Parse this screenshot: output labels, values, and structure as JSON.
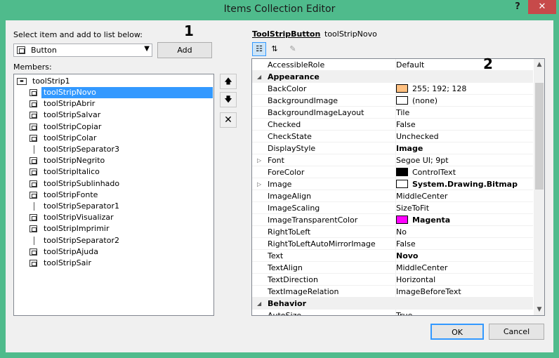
{
  "window": {
    "title": "Items Collection Editor",
    "help": "?",
    "close": "✕"
  },
  "left": {
    "select_label": "Select item and add to list below:",
    "combo_value": "Button",
    "add_label": "Add",
    "members_label": "Members:",
    "root": "toolStrip1",
    "items": [
      {
        "name": "toolStripNovo",
        "kind": "button"
      },
      {
        "name": "toolStripAbrir",
        "kind": "button"
      },
      {
        "name": "toolStripSalvar",
        "kind": "button"
      },
      {
        "name": "toolStripCopiar",
        "kind": "button"
      },
      {
        "name": "toolStripColar",
        "kind": "button"
      },
      {
        "name": "toolStripSeparator3",
        "kind": "separator"
      },
      {
        "name": "toolStripNegrito",
        "kind": "button"
      },
      {
        "name": "toolStripItalico",
        "kind": "button"
      },
      {
        "name": "toolStripSublinhado",
        "kind": "button"
      },
      {
        "name": "toolStripFonte",
        "kind": "button"
      },
      {
        "name": "toolStripSeparator1",
        "kind": "separator"
      },
      {
        "name": "toolStripVisualizar",
        "kind": "button"
      },
      {
        "name": "toolStripImprimir",
        "kind": "button"
      },
      {
        "name": "toolStripSeparator2",
        "kind": "separator"
      },
      {
        "name": "toolStripAjuda",
        "kind": "button"
      },
      {
        "name": "toolStripSair",
        "kind": "button"
      }
    ],
    "selected_index": 0,
    "move_up": "🡅",
    "move_down": "🡇",
    "remove": "✕"
  },
  "right": {
    "object_type": "ToolStripButton",
    "object_name": "toolStripNovo",
    "rows": [
      {
        "type": "prop",
        "name": "AccessibleRole",
        "value": "Default"
      },
      {
        "type": "cat",
        "name": "Appearance"
      },
      {
        "type": "prop",
        "name": "BackColor",
        "value": "255; 192; 128",
        "swatch": "#ffc080"
      },
      {
        "type": "prop",
        "name": "BackgroundImage",
        "value": "(none)",
        "swatch": "#ffffff"
      },
      {
        "type": "prop",
        "name": "BackgroundImageLayout",
        "value": "Tile"
      },
      {
        "type": "prop",
        "name": "Checked",
        "value": "False"
      },
      {
        "type": "prop",
        "name": "CheckState",
        "value": "Unchecked"
      },
      {
        "type": "prop",
        "name": "DisplayStyle",
        "value": "Image",
        "bold": true
      },
      {
        "type": "prop",
        "name": "Font",
        "value": "Segoe UI; 9pt",
        "expand": true
      },
      {
        "type": "prop",
        "name": "ForeColor",
        "value": "ControlText",
        "swatch": "#000000"
      },
      {
        "type": "prop",
        "name": "Image",
        "value": "System.Drawing.Bitmap",
        "bold": true,
        "expand": true,
        "swatch": "#ffffff"
      },
      {
        "type": "prop",
        "name": "ImageAlign",
        "value": "MiddleCenter"
      },
      {
        "type": "prop",
        "name": "ImageScaling",
        "value": "SizeToFit"
      },
      {
        "type": "prop",
        "name": "ImageTransparentColor",
        "value": "Magenta",
        "bold": true,
        "swatch": "#ff00ff"
      },
      {
        "type": "prop",
        "name": "RightToLeft",
        "value": "No"
      },
      {
        "type": "prop",
        "name": "RightToLeftAutoMirrorImage",
        "value": "False"
      },
      {
        "type": "prop",
        "name": "Text",
        "value": "Novo",
        "bold": true
      },
      {
        "type": "prop",
        "name": "TextAlign",
        "value": "MiddleCenter"
      },
      {
        "type": "prop",
        "name": "TextDirection",
        "value": "Horizontal"
      },
      {
        "type": "prop",
        "name": "TextImageRelation",
        "value": "ImageBeforeText"
      },
      {
        "type": "cat",
        "name": "Behavior"
      },
      {
        "type": "prop",
        "name": "AutoSize",
        "value": "True"
      }
    ]
  },
  "annotations": {
    "one": "1",
    "two": "2"
  },
  "footer": {
    "ok": "OK",
    "cancel": "Cancel"
  },
  "colors": {
    "titlebar": "#4fbb8c",
    "selection": "#3399ff",
    "close": "#c74a4a"
  }
}
